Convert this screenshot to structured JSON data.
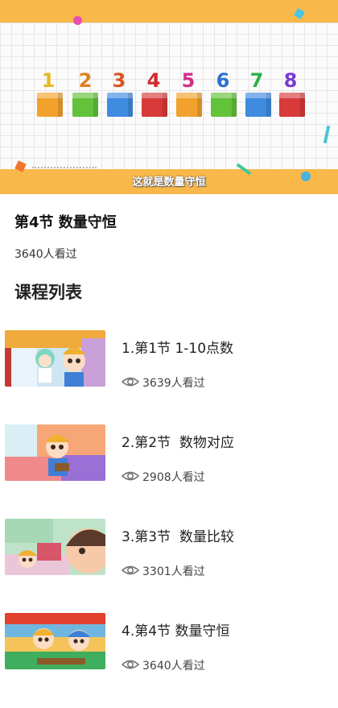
{
  "video": {
    "numbers": [
      "1",
      "2",
      "3",
      "4",
      "5",
      "6",
      "7",
      "8"
    ],
    "number_colors": [
      "#e8b820",
      "#e0801c",
      "#d9561f",
      "#d02a2e",
      "#d0308a",
      "#2f6fd0",
      "#2fae4c",
      "#7a3ad0"
    ],
    "cube_colors": [
      "#f2a12c",
      "#62c23a",
      "#3f8be0",
      "#d83a3a",
      "#f2a12c",
      "#62c23a",
      "#3f8be0",
      "#d83a3a"
    ],
    "caption": "这就是数量守恒"
  },
  "lesson": {
    "title": "第4节 数量守恒",
    "views": "3640人看过"
  },
  "course_list": {
    "heading": "课程列表",
    "items": [
      {
        "title": "1.第1节 1-10点数",
        "views": "3639人看过"
      },
      {
        "title": "2.第2节  数物对应",
        "views": "2908人看过"
      },
      {
        "title": "3.第3节  数量比较",
        "views": "3301人看过"
      },
      {
        "title": "4.第4节 数量守恒",
        "views": "3640人看过"
      }
    ]
  }
}
